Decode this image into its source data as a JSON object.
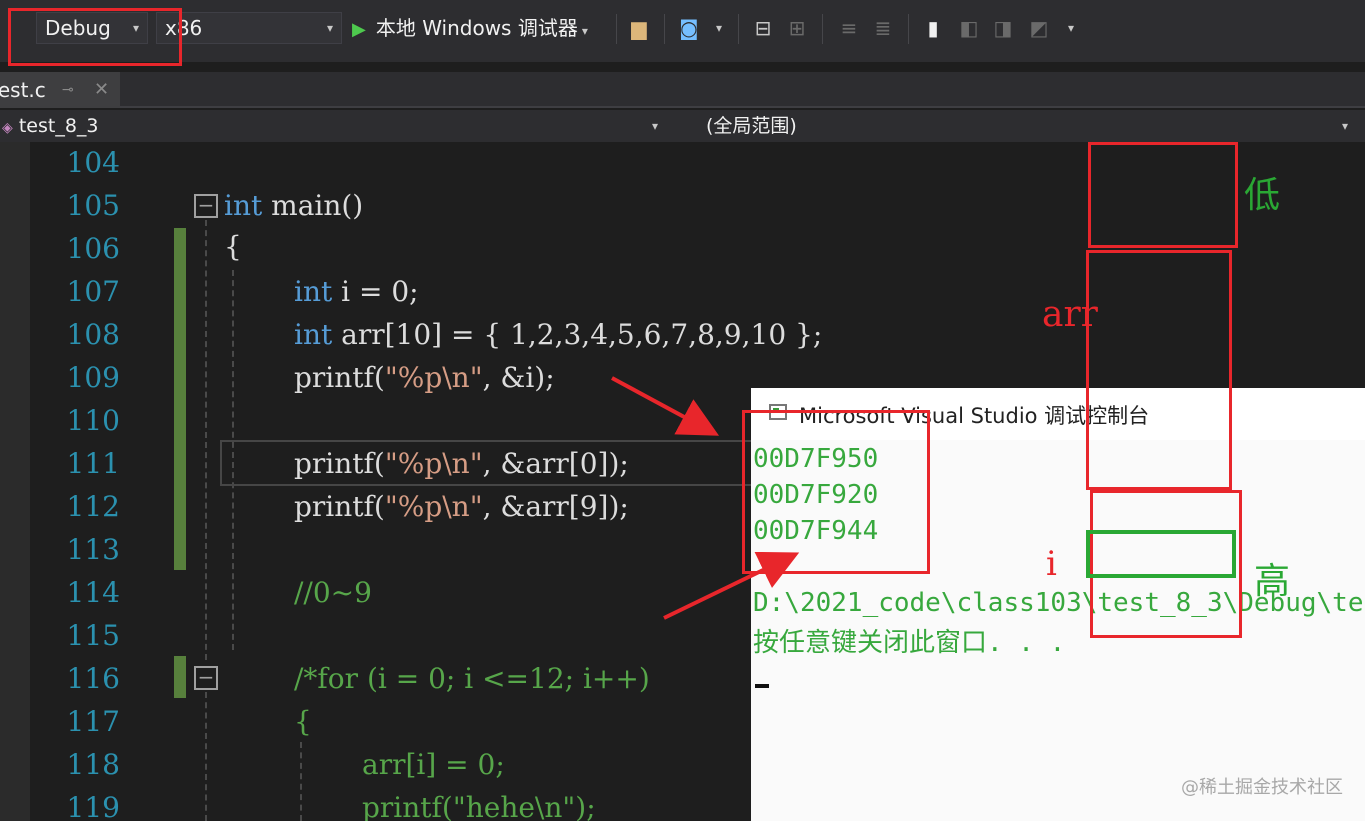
{
  "toolbar": {
    "config_value": "Debug",
    "platform_value": "x86",
    "run_label": "本地 Windows 调试器"
  },
  "tab": {
    "file_name": "test.c"
  },
  "navbar": {
    "project": "test_8_3",
    "scope": "(全局范围)"
  },
  "editor": {
    "line_numbers": [
      "104",
      "105",
      "106",
      "107",
      "108",
      "109",
      "110",
      "111",
      "112",
      "113",
      "114",
      "115",
      "116",
      "117",
      "118",
      "119"
    ],
    "lines": {
      "l105_kw": "int",
      "l105_rest": " main()",
      "l106": "{",
      "l107_kw": "int",
      "l107_rest": " i = 0;",
      "l108_kw": "int",
      "l108_rest": " arr[10] = { 1,2,3,4,5,6,7,8,9,10 };",
      "l109_a": "printf(",
      "l109_str": "\"%p\\n\"",
      "l109_b": ", &i);",
      "l111_a": "printf(",
      "l111_str": "\"%p\\n\"",
      "l111_b": ", &arr[0]);",
      "l112_a": "printf(",
      "l112_str": "\"%p\\n\"",
      "l112_b": ", &arr[9]);",
      "l114": "//0~9",
      "l116": "/*for (i = 0; i <=12; i++)",
      "l117": "{",
      "l118": "arr[i] = 0;",
      "l119": "printf(\"hehe\\n\");"
    }
  },
  "console": {
    "title": "Microsoft Visual Studio 调试控制台",
    "output": [
      "00D7F950",
      "00D7F920",
      "00D7F944",
      "",
      "D:\\2021_code\\class103\\test_8_3\\Debug\\te",
      "按任意键关闭此窗口. . ."
    ]
  },
  "annotations": {
    "low": "低",
    "arr": "arr",
    "i": "i",
    "high": "高",
    "colors": {
      "red": "#e8262b",
      "green": "#2aa834"
    }
  },
  "watermark": "@稀土掘金技术社区"
}
